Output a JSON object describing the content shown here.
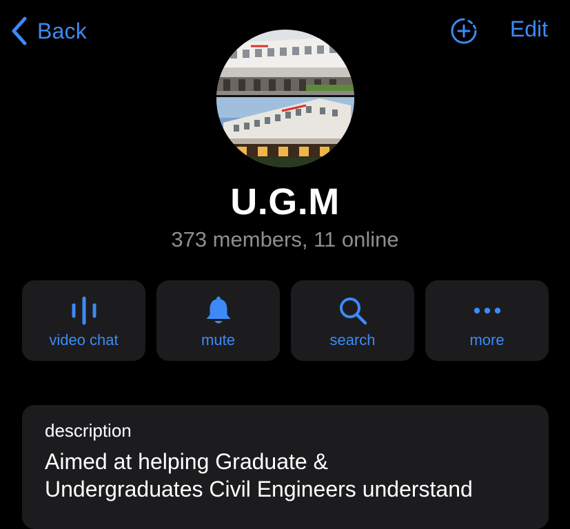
{
  "header": {
    "back_label": "Back",
    "edit_label": "Edit"
  },
  "profile": {
    "name": "U.G.M",
    "subtitle": "373 members, 11 online"
  },
  "actions": [
    {
      "label": "video chat",
      "icon": "voice-wave-icon"
    },
    {
      "label": "mute",
      "icon": "bell-icon"
    },
    {
      "label": "search",
      "icon": "magnifier-icon"
    },
    {
      "label": "more",
      "icon": "ellipsis-icon"
    }
  ],
  "description": {
    "header": "description",
    "line1": "Aimed at helping Graduate &",
    "line2": "Undergraduates Civil Engineers understand"
  },
  "colors": {
    "accent": "#3d8af7",
    "background": "#000000",
    "card": "#1c1c1e",
    "secondary_text": "#8e8e93"
  }
}
